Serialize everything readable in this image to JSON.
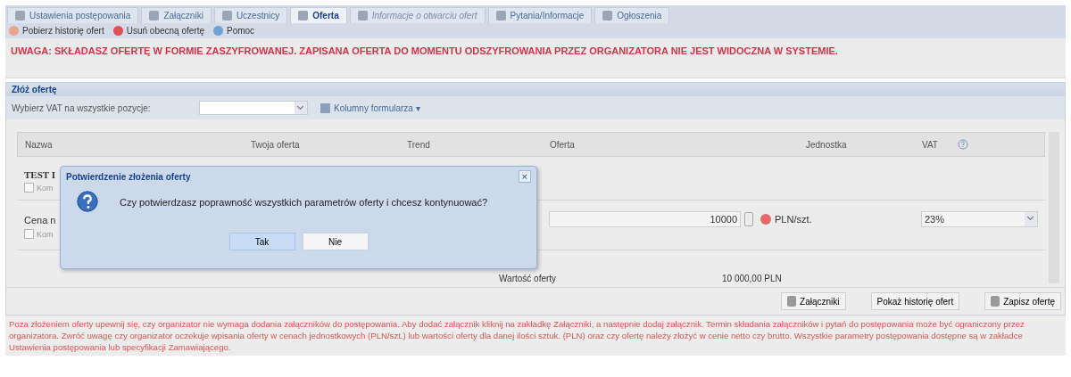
{
  "tabs": [
    {
      "label": "Ustawienia postępowania",
      "selected": false,
      "disabled": false
    },
    {
      "label": "Załączniki",
      "selected": false,
      "disabled": false
    },
    {
      "label": "Uczestnicy",
      "selected": false,
      "disabled": false
    },
    {
      "label": "Oferta",
      "selected": true,
      "disabled": false
    },
    {
      "label": "Informacje o otwarciu ofert",
      "selected": false,
      "disabled": true
    },
    {
      "label": "Pytania/Informacje",
      "selected": false,
      "disabled": false
    },
    {
      "label": "Ogłoszenia",
      "selected": false,
      "disabled": false
    }
  ],
  "toolbar": [
    "Pobierz historię ofert",
    "Usuń obecną ofertę",
    "Pomoc"
  ],
  "warning": "UWAGA: SKŁADASZ OFERTĘ W FORMIE ZASZYFROWANEJ. ZAPISANA OFERTA DO MOMENTU ODSZYFROWANIA PRZEZ ORGANIZATORA NIE JEST WIDOCZNA W SYSTEMIE.",
  "panel": {
    "title": "Złóż ofertę",
    "vat_label": "Wybierz VAT na wszystkie pozycje:",
    "columns_menu": "Kolumny formularza ▾"
  },
  "grid": {
    "columns": [
      "Nazwa",
      "Twoja oferta",
      "Trend",
      "Oferta",
      "Jednostka",
      "VAT"
    ],
    "group_title": "TEST I",
    "group_checkbox": {
      "label": "Kom",
      "checked": false
    },
    "row": {
      "name": "Cena n",
      "checkbox": {
        "label": "Kom",
        "checked": false
      },
      "offer": "10000",
      "unit": "PLN/szt.",
      "vat": "23%"
    },
    "summary": {
      "label": "Wartość oferty",
      "value": "10 000,00 PLN"
    }
  },
  "actions": [
    "Załączniki",
    "Pokaż historię ofert",
    "Zapisz ofertę"
  ],
  "footer_note": "Poza złożeniem oferty upewnij się, czy organizator nie wymaga dodania załączników do postępowania. Aby dodać załącznik kliknij na zakładkę Załączniki, a następnie dodaj załącznik. Termin składania załączników i pytań do postępowania może być ograniczony przez organizatora. Zwróć uwagę czy organizator oczekuje wpisania oferty w cenach jednostkowych (PLN/szt.) lub wartości oferty dla danej ilości sztuk. (PLN) oraz czy ofertę należy złożyć w cenie netto czy brutto. Wszystkie parametry postępowania dostępne są w zakładce Ustawienia postępowania lub specyfikacji Zamawiającego.",
  "dialog": {
    "title": "Potwierdzenie złożenia oferty",
    "close": "×",
    "message": "Czy potwierdzasz poprawność wszystkich parametrów oferty i chcesz kontynuować?",
    "buttons": [
      {
        "label": "Tak",
        "selected": true
      },
      {
        "label": "Nie",
        "selected": false
      }
    ]
  }
}
